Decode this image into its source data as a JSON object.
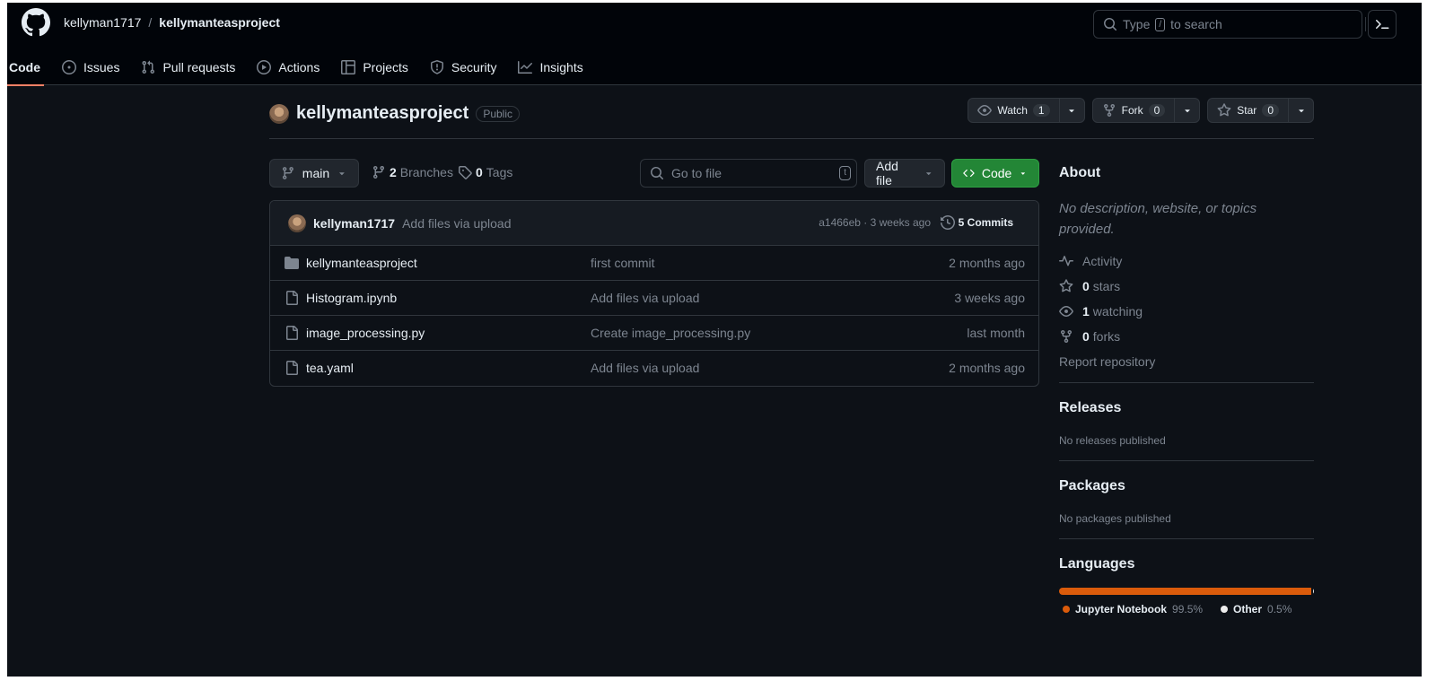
{
  "header": {
    "owner": "kellyman1717",
    "separator": "/",
    "repo": "kellymanteasproject",
    "search_prefix": "Type",
    "search_key": "/",
    "search_suffix": "to search"
  },
  "tabs": [
    {
      "label": "Code",
      "icon": "code-icon"
    },
    {
      "label": "Issues",
      "icon": "issue-icon"
    },
    {
      "label": "Pull requests",
      "icon": "pull-request-icon"
    },
    {
      "label": "Actions",
      "icon": "play-icon"
    },
    {
      "label": "Projects",
      "icon": "table-icon"
    },
    {
      "label": "Security",
      "icon": "shield-icon"
    },
    {
      "label": "Insights",
      "icon": "graph-icon"
    }
  ],
  "repo_header": {
    "name": "kellymanteasproject",
    "visibility": "Public",
    "watch": {
      "label": "Watch",
      "count": "1"
    },
    "fork": {
      "label": "Fork",
      "count": "0"
    },
    "star": {
      "label": "Star",
      "count": "0"
    }
  },
  "toolbar": {
    "branch": "main",
    "branches_count": "2",
    "branches_label": "Branches",
    "tags_count": "0",
    "tags_label": "Tags",
    "goto_placeholder": "Go to file",
    "goto_key": "t",
    "add_file": "Add file",
    "code": "Code"
  },
  "latest_commit": {
    "author": "kellyman1717",
    "message": "Add files via upload",
    "meta": "a1466eb · 3 weeks ago",
    "commits": "5 Commits"
  },
  "files": [
    {
      "type": "folder",
      "name": "kellymanteasproject",
      "message": "first commit",
      "date": "2 months ago"
    },
    {
      "type": "file",
      "name": "Histogram.ipynb",
      "message": "Add files via upload",
      "date": "3 weeks ago"
    },
    {
      "type": "file",
      "name": "image_processing.py",
      "message": "Create image_processing.py",
      "date": "last month"
    },
    {
      "type": "file",
      "name": "tea.yaml",
      "message": "Add files via upload",
      "date": "2 months ago"
    }
  ],
  "about": {
    "title": "About",
    "description": "No description, website, or topics provided.",
    "activity": "Activity",
    "stars_count": "0",
    "stars_label": "stars",
    "watching_count": "1",
    "watching_label": "watching",
    "forks_count": "0",
    "forks_label": "forks",
    "report": "Report repository"
  },
  "releases": {
    "title": "Releases",
    "text": "No releases published"
  },
  "packages": {
    "title": "Packages",
    "text": "No packages published"
  },
  "languages": {
    "title": "Languages",
    "items": [
      {
        "name": "Jupyter Notebook",
        "percent": "99.5%",
        "value": 99.5,
        "color": "#DA5B0B"
      },
      {
        "name": "Other",
        "percent": "0.5%",
        "value": 0.5,
        "color": "#ededed"
      }
    ]
  },
  "colors": {
    "background": "#0d1117",
    "topbar": "#010409",
    "accent_green": "#238636",
    "active_tab_underline": "#f78166"
  }
}
